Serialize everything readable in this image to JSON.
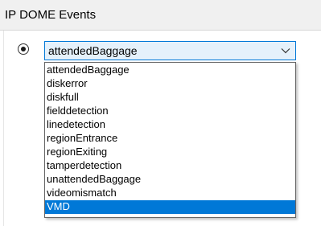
{
  "panel": {
    "title": "IP DOME Events"
  },
  "event_select": {
    "selected_value": "attendedBaggage",
    "radio_checked": true,
    "options": [
      "attendedBaggage",
      "diskerror",
      "diskfull",
      "fielddetection",
      "linedetection",
      "regionEntrance",
      "regionExiting",
      "tamperdetection",
      "unattendedBaggage",
      "videomismatch",
      "VMD"
    ],
    "highlighted_option": "VMD",
    "icons": {
      "radio": "radio-button-icon",
      "arrow": "chevron-down-icon"
    }
  },
  "colors": {
    "accent": "#0078d7",
    "combo_background": "#e5f1fb",
    "header_background": "#f0f0f0"
  }
}
